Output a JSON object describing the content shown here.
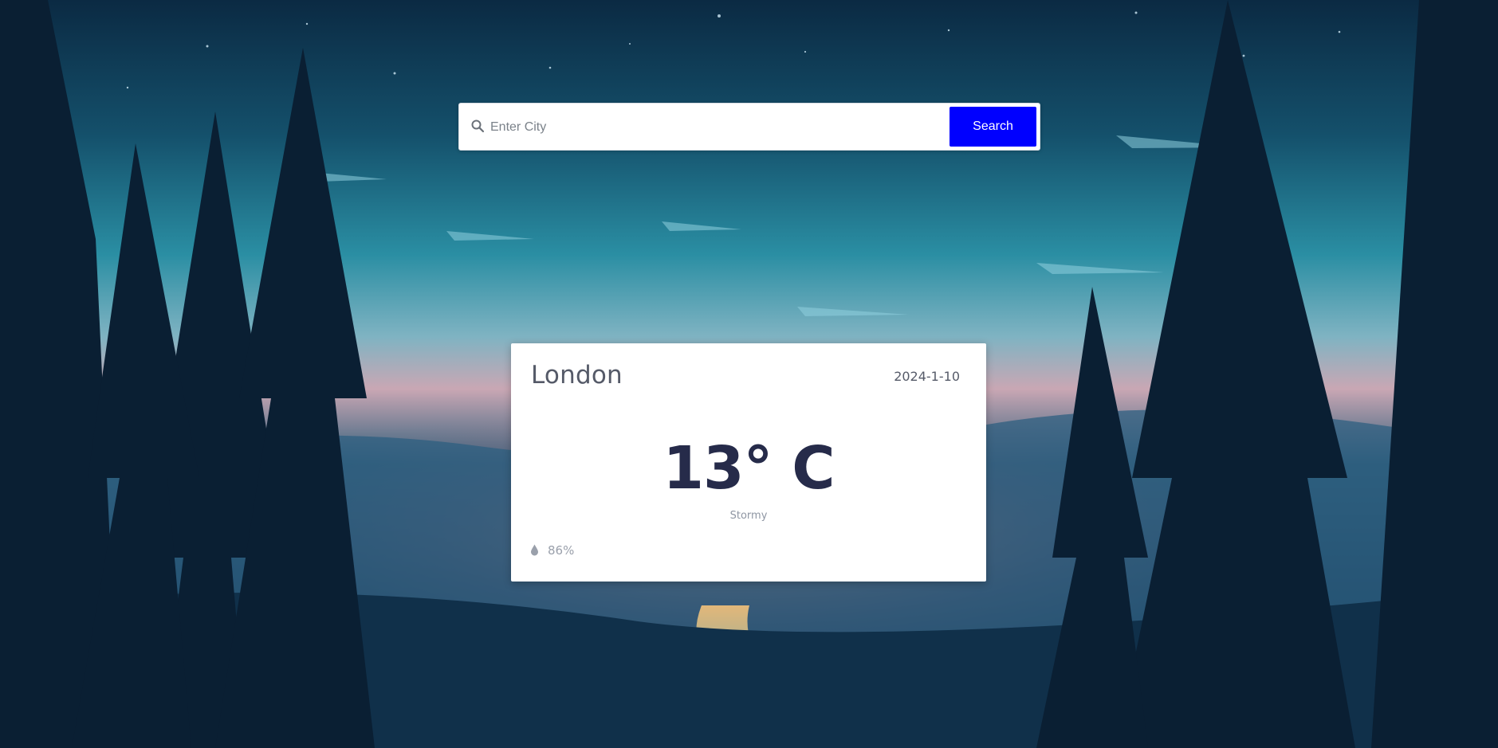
{
  "search": {
    "placeholder": "Enter City",
    "value": "",
    "button_label": "Search",
    "button_color": "#0000ff",
    "icon": "search-icon"
  },
  "weather": {
    "city": "London",
    "date": "2024-1-10",
    "temperature": "13° C",
    "condition": "Stormy",
    "humidity_icon": "droplet-icon",
    "humidity": "86%"
  }
}
